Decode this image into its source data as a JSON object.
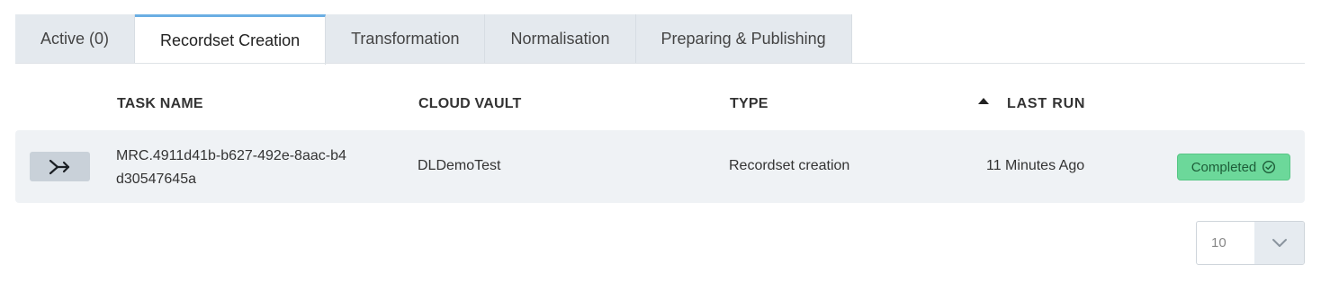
{
  "tabs": [
    {
      "label": "Active (0)",
      "active": false
    },
    {
      "label": "Recordset Creation",
      "active": true
    },
    {
      "label": "Transformation",
      "active": false
    },
    {
      "label": "Normalisation",
      "active": false
    },
    {
      "label": "Preparing & Publishing",
      "active": false
    }
  ],
  "table": {
    "headers": {
      "task_name": "TASK NAME",
      "cloud_vault": "CLOUD VAULT",
      "type": "TYPE",
      "last_run": "LAST RUN"
    },
    "sort": {
      "column": "last_run",
      "direction": "ascending",
      "icon": "sort-up-icon"
    },
    "rows": [
      {
        "icon": "merge-arrow-icon",
        "task_name": "MRC.4911d41b-b627-492e-8aac-b4d30547645a",
        "cloud_vault": "DLDemoTest",
        "type": "Recordset creation",
        "last_run": "11 Minutes Ago",
        "status": "Completed",
        "status_icon": "check-circle-icon",
        "status_color": "#6cd89a"
      }
    ]
  },
  "pagination": {
    "page_size": "10",
    "dropdown_icon": "chevron-down-icon"
  },
  "colors": {
    "active_tab_accent": "#6aaee3",
    "tab_background": "#e4e9ee",
    "row_background": "#eff2f5"
  }
}
